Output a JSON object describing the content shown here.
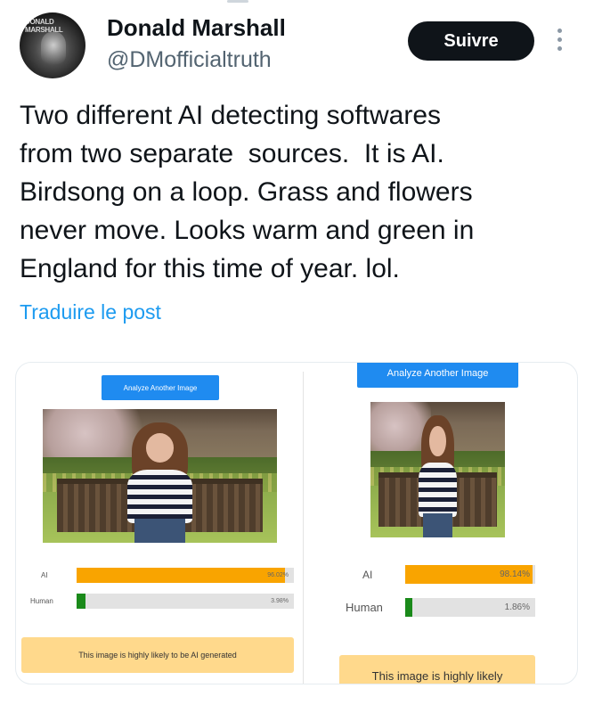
{
  "user": {
    "display_name": "Donald Marshall",
    "handle": "@DMofficialtruth",
    "avatar_text": "DONALD MARSHALL"
  },
  "follow_label": "Suivre",
  "more_icon": "more-vertical-icon",
  "tweet": {
    "text": "Two different AI detecting softwares\nfrom two separate  sources.  It is AI.\nBirdsong on a loop. Grass and flowers\nnever move. Looks warm and green in\nEngland for this time of year. lol.",
    "translate_label": "Traduire le post"
  },
  "panels": {
    "left": {
      "button_label": "Analyze Another Image",
      "ai_label": "AI",
      "ai_value": "96.02%",
      "ai_fraction": 0.9602,
      "human_label": "Human",
      "human_value": "3.98%",
      "human_fraction": 0.0398,
      "result_text": "This image is highly likely to be AI generated"
    },
    "right": {
      "button_label": "Analyze Another Image",
      "ai_label": "AI",
      "ai_value": "98.14%",
      "ai_fraction": 0.9814,
      "human_label": "Human",
      "human_value": "1.86%",
      "human_fraction": 0.0186,
      "result_text": "This image is highly likely"
    }
  },
  "colors": {
    "ai_bar": "#f9a400",
    "human_bar": "#1a8a1a",
    "link": "#1d9bf0"
  }
}
